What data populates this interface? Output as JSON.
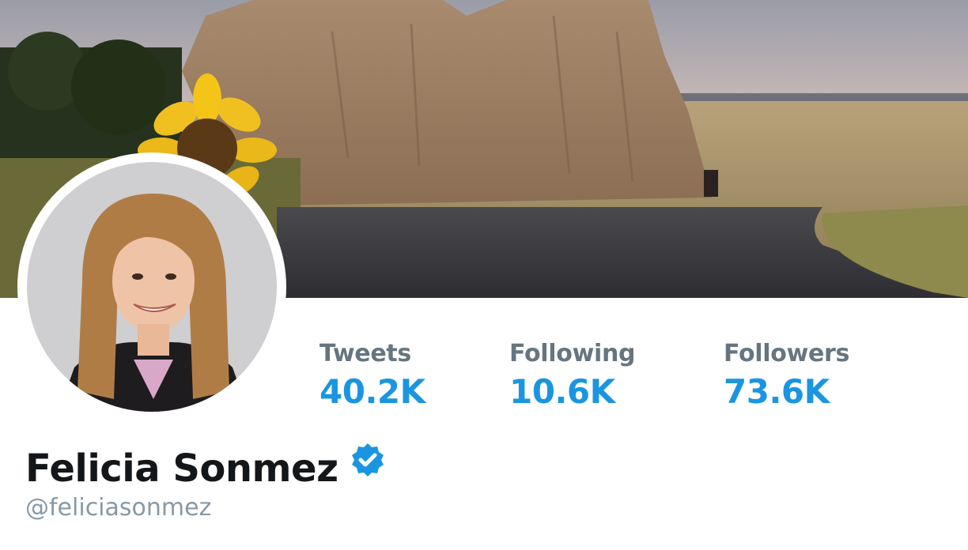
{
  "profile": {
    "name": "Felicia Sonmez",
    "handle": "@feliciasonmez",
    "verified": true
  },
  "stats": {
    "tweets": {
      "label": "Tweets",
      "value": "40.2K"
    },
    "following": {
      "label": "Following",
      "value": "10.6K"
    },
    "followers": {
      "label": "Followers",
      "value": "73.6K"
    }
  },
  "colors": {
    "accent": "#1b95e0",
    "label_gray": "#66757f",
    "handle_gray": "#8899a6",
    "name": "#14171a"
  },
  "icons": {
    "verified": "verified-badge-icon"
  }
}
